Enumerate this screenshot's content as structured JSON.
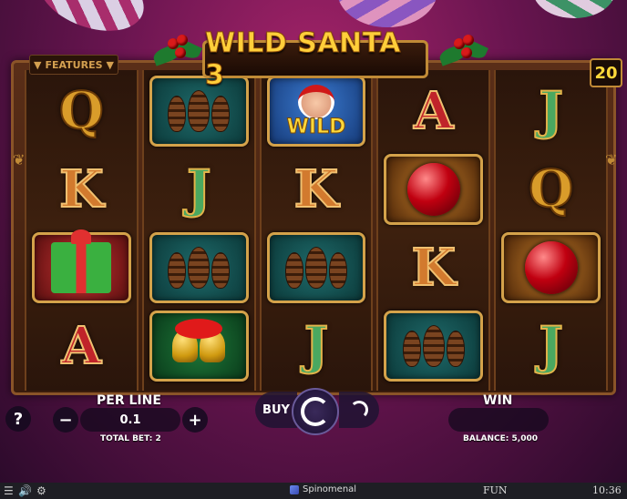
{
  "game": {
    "title": "WILD SANTA 3",
    "features_label": "FEATURES",
    "paylines": "20"
  },
  "reels": [
    [
      "Q",
      "K",
      "gift",
      "A"
    ],
    [
      "pinecone",
      "J",
      "pinecone",
      "bells"
    ],
    [
      "wild",
      "K",
      "pinecone",
      "J"
    ],
    [
      "A",
      "ornament",
      "K",
      "pinecone"
    ],
    [
      "J",
      "Q",
      "ornament",
      "J"
    ]
  ],
  "wild_label": "WILD",
  "controls": {
    "help_label": "?",
    "per_line_label": "PER LINE",
    "per_line_value": "0.1",
    "minus_label": "−",
    "plus_label": "+",
    "total_bet_label": "TOTAL BET: 2",
    "buy_label": "BUY",
    "win_label": "WIN",
    "win_value": "",
    "balance_label": "BALANCE: 5,000"
  },
  "footer": {
    "brand": "Spinomenal",
    "mode": "FUN",
    "time": "10:36"
  }
}
